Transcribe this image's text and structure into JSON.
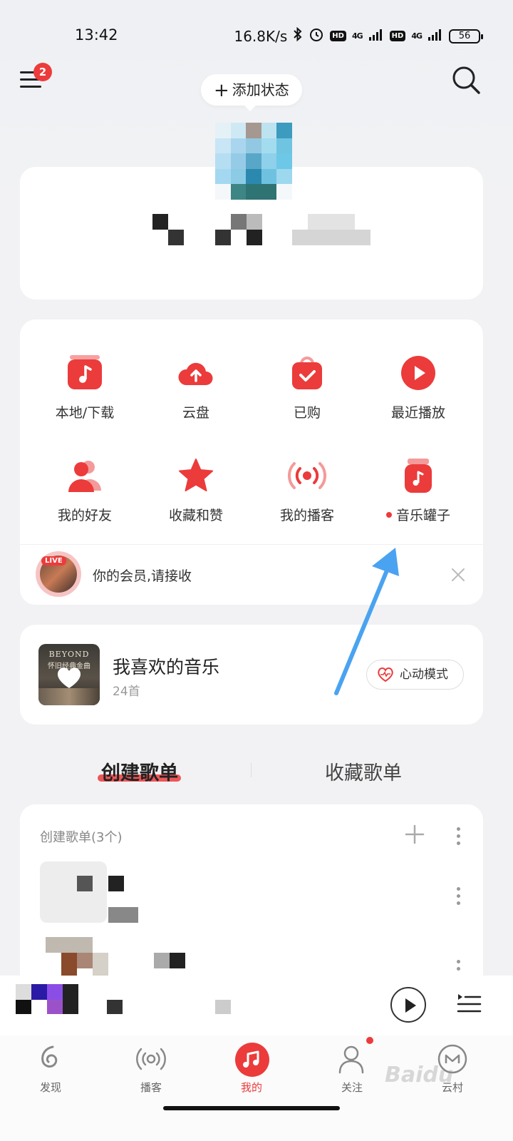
{
  "status_bar": {
    "time": "13:42",
    "speed": "16.8K/s",
    "hd1": "HD",
    "net1": "4G",
    "hd2": "HD",
    "net2": "4G",
    "battery": "56"
  },
  "header": {
    "menu_badge": "2",
    "add_status": "添加状态"
  },
  "features": [
    {
      "label": "本地/下载",
      "icon": "music-note-icon"
    },
    {
      "label": "云盘",
      "icon": "cloud-upload-icon"
    },
    {
      "label": "已购",
      "icon": "shopping-bag-icon"
    },
    {
      "label": "最近播放",
      "icon": "play-circle-icon"
    },
    {
      "label": "我的好友",
      "icon": "friends-icon"
    },
    {
      "label": "收藏和赞",
      "icon": "star-icon"
    },
    {
      "label": "我的播客",
      "icon": "podcast-icon"
    },
    {
      "label": "音乐罐子",
      "icon": "music-jar-icon"
    }
  ],
  "promo": {
    "live": "LIVE",
    "text": "你的会员,请接收"
  },
  "liked": {
    "cover_line1": "BEYOND",
    "cover_line2": "怀旧经典金曲",
    "title": "我喜欢的音乐",
    "count": "24首",
    "heart_mode": "心动模式"
  },
  "tabs": {
    "created": "创建歌单",
    "collected": "收藏歌单"
  },
  "list": {
    "header": "创建歌单(3个)"
  },
  "nav": [
    {
      "label": "发现",
      "icon": "discover-icon"
    },
    {
      "label": "播客",
      "icon": "podcast-icon"
    },
    {
      "label": "我的",
      "icon": "music-note-icon"
    },
    {
      "label": "关注",
      "icon": "follow-icon"
    },
    {
      "label": "云村",
      "icon": "village-icon"
    }
  ],
  "watermark": "Baidu",
  "colors": {
    "accent": "#ec3b3b",
    "annotation_arrow": "#4aa3f0"
  }
}
